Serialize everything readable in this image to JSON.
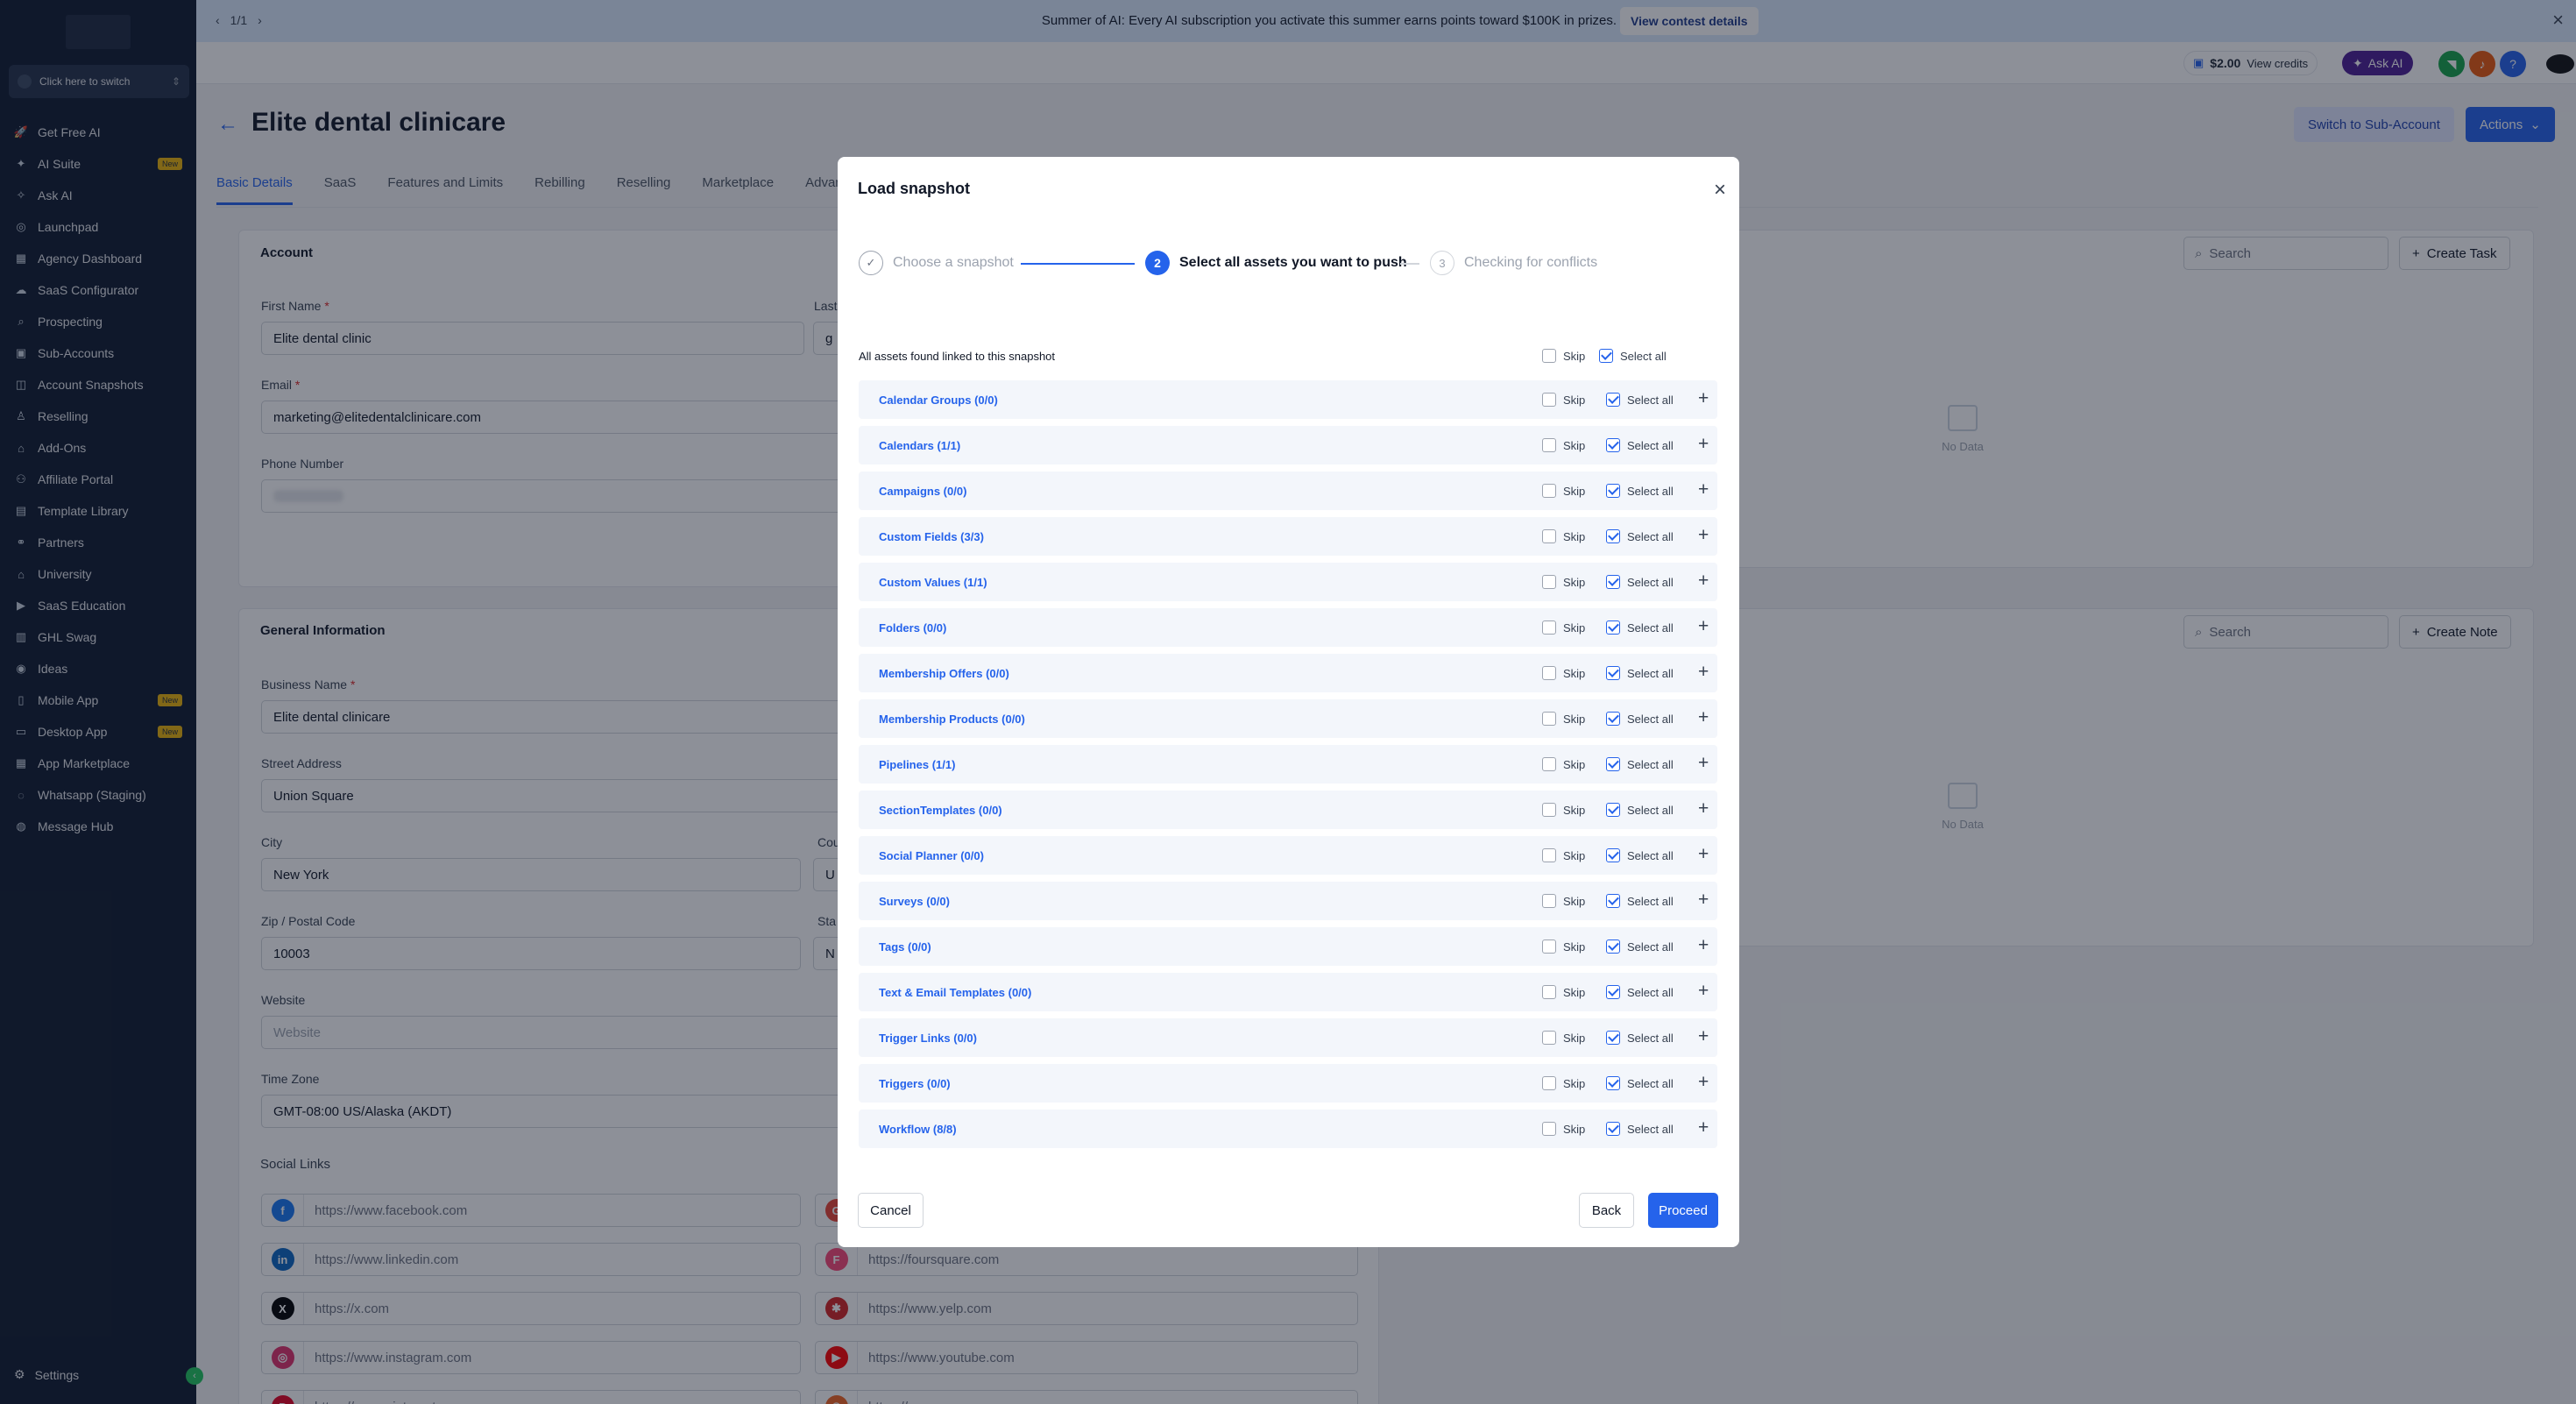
{
  "sidebar": {
    "switcher_label": "Click here to switch",
    "items": [
      {
        "label": "Get Free AI",
        "icon": "rocket-icon",
        "glyph": "🚀",
        "badge": ""
      },
      {
        "label": "AI Suite",
        "icon": "sparkles-icon",
        "glyph": "✦",
        "badge": "New"
      },
      {
        "label": "Ask AI",
        "icon": "sparkle-icon",
        "glyph": "✧",
        "badge": ""
      },
      {
        "label": "Launchpad",
        "icon": "launchpad-icon",
        "glyph": "◎",
        "badge": ""
      },
      {
        "label": "Agency Dashboard",
        "icon": "dashboard-icon",
        "glyph": "▦",
        "badge": ""
      },
      {
        "label": "SaaS Configurator",
        "icon": "saas-icon",
        "glyph": "☁",
        "badge": ""
      },
      {
        "label": "Prospecting",
        "icon": "prospecting-icon",
        "glyph": "⌕",
        "badge": ""
      },
      {
        "label": "Sub-Accounts",
        "icon": "sub-accounts-icon",
        "glyph": "▣",
        "badge": ""
      },
      {
        "label": "Account Snapshots",
        "icon": "snapshots-icon",
        "glyph": "◫",
        "badge": ""
      },
      {
        "label": "Reselling",
        "icon": "reselling-icon",
        "glyph": "♙",
        "badge": ""
      },
      {
        "label": "Add-Ons",
        "icon": "add-ons-icon",
        "glyph": "⌂",
        "badge": ""
      },
      {
        "label": "Affiliate Portal",
        "icon": "affiliate-icon",
        "glyph": "⚇",
        "badge": ""
      },
      {
        "label": "Template Library",
        "icon": "template-library-icon",
        "glyph": "▤",
        "badge": ""
      },
      {
        "label": "Partners",
        "icon": "partners-icon",
        "glyph": "⚭",
        "badge": ""
      },
      {
        "label": "University",
        "icon": "university-icon",
        "glyph": "⌂",
        "badge": ""
      },
      {
        "label": "SaaS Education",
        "icon": "education-icon",
        "glyph": "▶",
        "badge": ""
      },
      {
        "label": "GHL Swag",
        "icon": "swag-icon",
        "glyph": "▥",
        "badge": ""
      },
      {
        "label": "Ideas",
        "icon": "lightbulb-icon",
        "glyph": "◉",
        "badge": ""
      },
      {
        "label": "Mobile App",
        "icon": "mobile-icon",
        "glyph": "▯",
        "badge": "New"
      },
      {
        "label": "Desktop App",
        "icon": "desktop-icon",
        "glyph": "▭",
        "badge": "New"
      },
      {
        "label": "App Marketplace",
        "icon": "marketplace-icon",
        "glyph": "▦",
        "badge": ""
      },
      {
        "label": "Whatsapp (Staging)",
        "icon": "whatsapp-icon",
        "glyph": "◌",
        "badge": ""
      },
      {
        "label": "Message Hub",
        "icon": "message-icon",
        "glyph": "◍",
        "badge": ""
      }
    ],
    "settings_label": "Settings"
  },
  "banner": {
    "pager": "1/1",
    "text": "Summer of AI: Every AI subscription you activate this summer earns points toward $100K in prizes.",
    "button": "View contest details"
  },
  "topbar": {
    "credits_amount": "$2.00",
    "credits_label": "View credits",
    "ask_ai": "Ask AI"
  },
  "page": {
    "title": "Elite dental clinicare",
    "switch_button": "Switch to Sub-Account",
    "actions_button": "Actions",
    "tabs": [
      "Basic Details",
      "SaaS",
      "Features and Limits",
      "Rebilling",
      "Reselling",
      "Marketplace",
      "Advanc"
    ]
  },
  "account": {
    "title": "Account",
    "first_name_label": "First Name",
    "first_name": "Elite dental clinic",
    "last_name_label": "Last",
    "last_name_partial": "g",
    "email_label": "Email",
    "email": "marketing@elitedentalclinicare.com",
    "phone_label": "Phone Number"
  },
  "general": {
    "title": "General Information",
    "business_name_label": "Business Name",
    "business_name": "Elite dental clinicare",
    "street_label": "Street Address",
    "street": "Union Square",
    "city_label": "City",
    "city": "New York",
    "country_label_partial": "Cou",
    "country_partial": "U",
    "zip_label": "Zip / Postal Code",
    "zip": "10003",
    "state_label_partial": "Sta",
    "state_partial": "N",
    "website_label": "Website",
    "website_placeholder": "Website",
    "timezone_label": "Time Zone",
    "timezone": "GMT-08:00 US/Alaska (AKDT)",
    "social_label": "Social Links",
    "social_left": [
      {
        "icon": "facebook-icon",
        "glyph": "f",
        "color": "#1877f2",
        "url": "https://www.facebook.com"
      },
      {
        "icon": "linkedin-icon",
        "glyph": "in",
        "color": "#0a66c2",
        "url": "https://www.linkedin.com"
      },
      {
        "icon": "x-icon",
        "glyph": "X",
        "color": "#000000",
        "url": "https://x.com"
      },
      {
        "icon": "instagram-icon",
        "glyph": "◎",
        "color": "#e1306c",
        "url": "https://www.instagram.com"
      },
      {
        "icon": "pinterest-icon",
        "glyph": "P",
        "color": "#e60023",
        "url": "https://www.pinterest.com"
      }
    ],
    "social_right": [
      {
        "icon": "google-icon",
        "glyph": "G",
        "color": "#ea4335",
        "url": ""
      },
      {
        "icon": "foursquare-icon",
        "glyph": "F",
        "color": "#f94877",
        "url": "https://foursquare.com"
      },
      {
        "icon": "yelp-icon",
        "glyph": "✱",
        "color": "#d32323",
        "url": "https://www.yelp.com"
      },
      {
        "icon": "youtube-icon",
        "glyph": "▶",
        "color": "#ff0000",
        "url": "https://www.youtube.com"
      },
      {
        "icon": "rss-icon",
        "glyph": "◉",
        "color": "#f26522",
        "url": "https://rss.com"
      }
    ]
  },
  "right_panels": {
    "search_placeholder": "Search",
    "create_task": "Create Task",
    "create_note": "Create Note",
    "no_data": "No Data"
  },
  "modal": {
    "title": "Load snapshot",
    "steps": [
      {
        "num": "✓",
        "label": "Choose a snapshot",
        "state": "done"
      },
      {
        "num": "2",
        "label": "Select all assets you want to push",
        "state": "active"
      },
      {
        "num": "3",
        "label": "Checking for conflicts",
        "state": "pending"
      }
    ],
    "all_assets_label": "All assets found linked to this snapshot",
    "skip_label": "Skip",
    "select_all_label": "Select all",
    "assets": [
      "Calendar Groups (0/0)",
      "Calendars (1/1)",
      "Campaigns (0/0)",
      "Custom Fields (3/3)",
      "Custom Values (1/1)",
      "Folders (0/0)",
      "Membership Offers (0/0)",
      "Membership Products (0/0)",
      "Pipelines (1/1)",
      "SectionTemplates (0/0)",
      "Social Planner (0/0)",
      "Surveys (0/0)",
      "Tags (0/0)",
      "Text & Email Templates (0/0)",
      "Trigger Links (0/0)",
      "Triggers (0/0)",
      "Workflow (8/8)"
    ],
    "cancel": "Cancel",
    "back": "Back",
    "proceed": "Proceed"
  },
  "colors": {
    "primary": "#2563eb",
    "sidebar_bg": "#0f1a2e",
    "banner_bg": "#dbeafe"
  }
}
